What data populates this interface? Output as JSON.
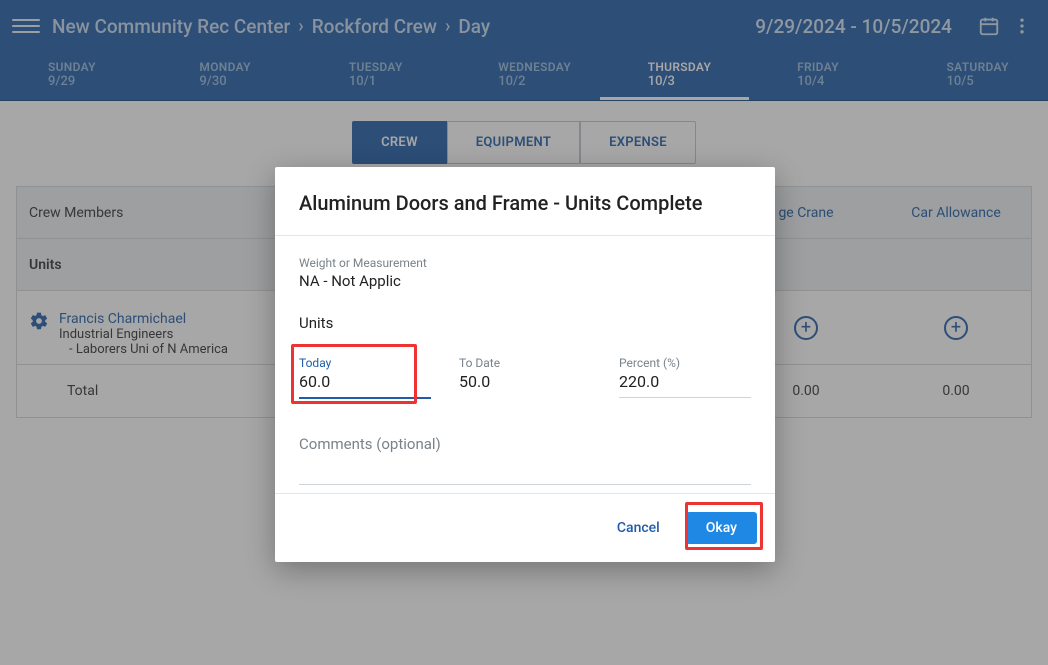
{
  "header": {
    "breadcrumbs": [
      "New Community Rec Center",
      "Rockford Crew",
      "Day"
    ],
    "date_range": "9/29/2024 - 10/5/2024"
  },
  "days": [
    {
      "name": "SUNDAY",
      "date": "9/29",
      "active": false
    },
    {
      "name": "MONDAY",
      "date": "9/30",
      "active": false
    },
    {
      "name": "TUESDAY",
      "date": "10/1",
      "active": false
    },
    {
      "name": "WEDNESDAY",
      "date": "10/2",
      "active": false
    },
    {
      "name": "THURSDAY",
      "date": "10/3",
      "active": true
    },
    {
      "name": "FRIDAY",
      "date": "10/4",
      "active": false
    },
    {
      "name": "SATURDAY",
      "date": "10/5",
      "active": false
    }
  ],
  "subtabs": {
    "crew": "CREW",
    "equipment": "EQUIPMENT",
    "expense": "EXPENSE"
  },
  "table": {
    "members_header": "Crew Members",
    "col_crane": "ge Crane",
    "col_allowance": "Car Allowance",
    "units_header": "Units",
    "person": {
      "name": "Francis Charmichael",
      "role": "Industrial Engineers",
      "union": "- Laborers Uni of N America"
    },
    "total_label": "Total",
    "total_crane": "0.00",
    "total_allowance": "0.00"
  },
  "dialog": {
    "title": "Aluminum Doors and Frame - Units Complete",
    "weight_label": "Weight or Measurement",
    "weight_value": "NA - Not Applic",
    "units_label": "Units",
    "today_label": "Today",
    "today_value": "60.0",
    "todate_label": "To Date",
    "todate_value": "50.0",
    "percent_label": "Percent (%)",
    "percent_value": "220.0",
    "comments_label": "Comments (optional)",
    "cancel": "Cancel",
    "okay": "Okay"
  }
}
